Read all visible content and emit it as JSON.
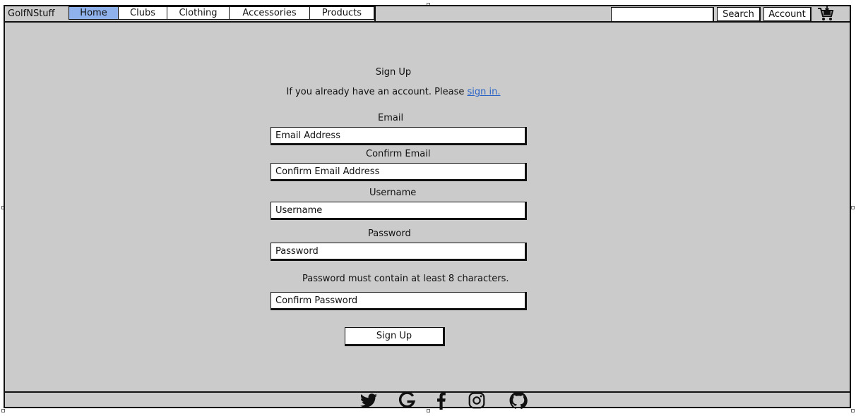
{
  "app": {
    "brand": "GolfNStuff"
  },
  "nav": {
    "tabs": [
      {
        "label": "Home",
        "active": true
      },
      {
        "label": "Clubs",
        "active": false
      },
      {
        "label": "Clothing",
        "active": false
      },
      {
        "label": "Accessories",
        "active": false
      },
      {
        "label": "Products",
        "active": false
      }
    ],
    "active_color": "#8fb2ec"
  },
  "header": {
    "search_placeholder": "",
    "search_label": "Search",
    "account_label": "Account",
    "cart_icon": "cart-icon"
  },
  "signup": {
    "title": "Sign Up",
    "intro_text": "If you already have an account. Please",
    "signin_link": "sign in.",
    "link_color": "#2a63c6",
    "email_label": "Email",
    "email_placeholder": "Email Address",
    "confirm_email_label": "Confirm Email",
    "confirm_email_placeholder": "Confirm Email Address",
    "username_label": "Username",
    "username_placeholder": "Username",
    "password_label": "Password",
    "password_placeholder": "Password",
    "password_hint": "Password must contain at least 8 characters.",
    "confirm_password_placeholder": "Confirm Password",
    "submit_label": "Sign Up"
  },
  "footer": {
    "social_icons": [
      "twitter-icon",
      "google-icon",
      "facebook-icon",
      "instagram-icon",
      "github-icon"
    ]
  },
  "colors": {
    "canvas_bg": "#cbcbcb",
    "border": "#111111"
  }
}
